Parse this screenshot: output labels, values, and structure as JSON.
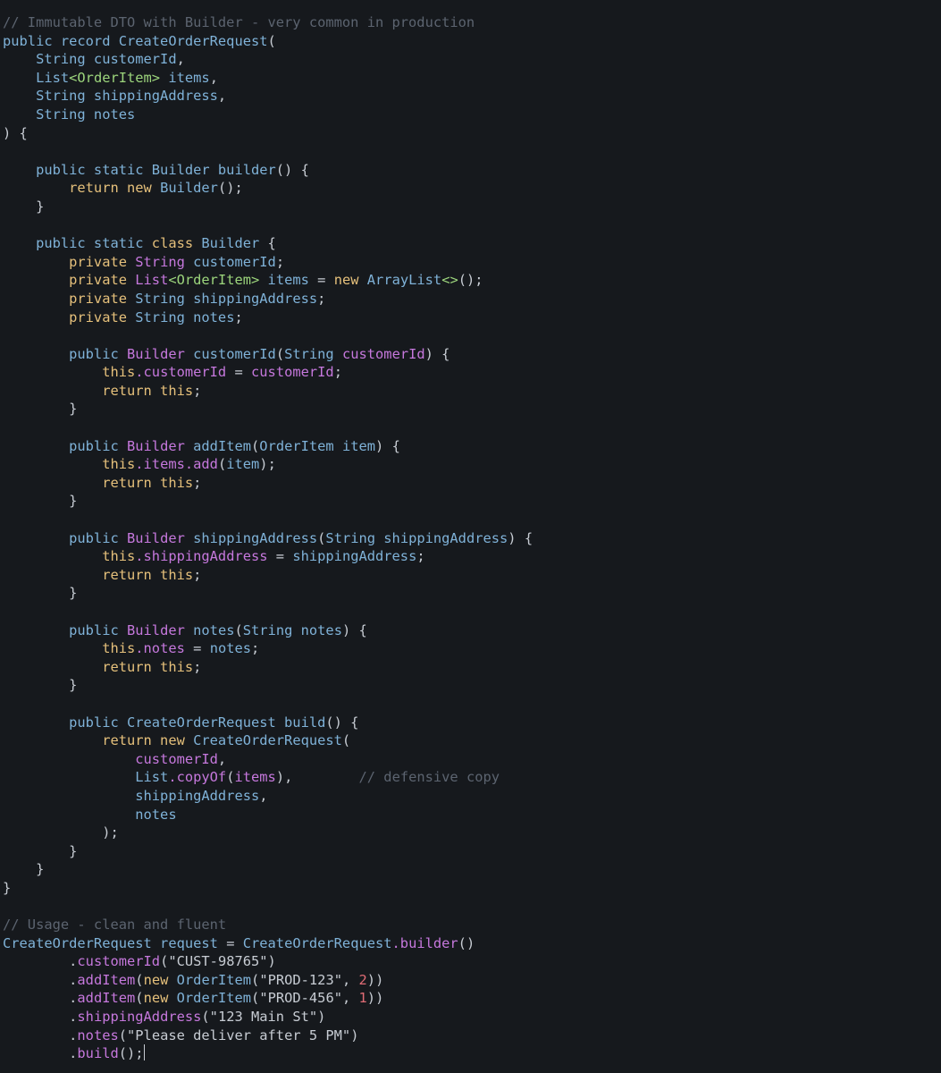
{
  "editor": {
    "colors": {
      "background": "#16191d",
      "comment": "#5c6470",
      "keyword": "#7fb2d8",
      "keyword_accent": "#e5c07b",
      "type": "#7fb2d8",
      "class_name": "#c678dd",
      "generic_type": "#9cd57c",
      "member": "#c678dd",
      "string": "#c7ccd3",
      "number": "#e06c75",
      "punctuation": "#c7ccd3"
    },
    "lines": [
      [
        {
          "t": "// Immutable DTO with Builder - very common in production",
          "c": "comment"
        }
      ],
      [
        {
          "t": "public record CreateOrderRequest",
          "c": "keyword"
        },
        {
          "t": "(",
          "c": "punctuation"
        }
      ],
      [
        {
          "t": "    String customerId",
          "c": "keyword"
        },
        {
          "t": ",",
          "c": "punctuation"
        }
      ],
      [
        {
          "t": "    List",
          "c": "keyword"
        },
        {
          "t": "<OrderItem>",
          "c": "generic_type"
        },
        {
          "t": " items",
          "c": "keyword"
        },
        {
          "t": ",",
          "c": "punctuation"
        }
      ],
      [
        {
          "t": "    String shippingAddress",
          "c": "keyword"
        },
        {
          "t": ",",
          "c": "punctuation"
        }
      ],
      [
        {
          "t": "    String notes",
          "c": "keyword"
        }
      ],
      [
        {
          "t": ") {",
          "c": "punctuation"
        }
      ],
      [
        {
          "t": "",
          "c": "punctuation"
        }
      ],
      [
        {
          "t": "    public static Builder builder",
          "c": "keyword"
        },
        {
          "t": "() {",
          "c": "punctuation"
        }
      ],
      [
        {
          "t": "        return new",
          "c": "keyword_accent"
        },
        {
          "t": " Builder",
          "c": "keyword"
        },
        {
          "t": "();",
          "c": "punctuation"
        }
      ],
      [
        {
          "t": "    }",
          "c": "punctuation"
        }
      ],
      [
        {
          "t": "",
          "c": "punctuation"
        }
      ],
      [
        {
          "t": "    public static ",
          "c": "keyword"
        },
        {
          "t": "class",
          "c": "keyword_accent"
        },
        {
          "t": " Builder",
          "c": "keyword"
        },
        {
          "t": " {",
          "c": "punctuation"
        }
      ],
      [
        {
          "t": "        private",
          "c": "keyword_accent"
        },
        {
          "t": " String",
          "c": "class_name"
        },
        {
          "t": " customerId",
          "c": "keyword"
        },
        {
          "t": ";",
          "c": "punctuation"
        }
      ],
      [
        {
          "t": "        private",
          "c": "keyword_accent"
        },
        {
          "t": " List",
          "c": "class_name"
        },
        {
          "t": "<OrderItem>",
          "c": "generic_type"
        },
        {
          "t": " items",
          "c": "keyword"
        },
        {
          "t": " = ",
          "c": "punctuation"
        },
        {
          "t": "new",
          "c": "keyword_accent"
        },
        {
          "t": " ArrayList",
          "c": "keyword"
        },
        {
          "t": "<>",
          "c": "generic_type"
        },
        {
          "t": "();",
          "c": "punctuation"
        }
      ],
      [
        {
          "t": "        private",
          "c": "keyword_accent"
        },
        {
          "t": " String shippingAddress",
          "c": "keyword"
        },
        {
          "t": ";",
          "c": "punctuation"
        }
      ],
      [
        {
          "t": "        private",
          "c": "keyword_accent"
        },
        {
          "t": " String notes",
          "c": "keyword"
        },
        {
          "t": ";",
          "c": "punctuation"
        }
      ],
      [
        {
          "t": "",
          "c": "punctuation"
        }
      ],
      [
        {
          "t": "        public",
          "c": "keyword"
        },
        {
          "t": " Builder",
          "c": "class_name"
        },
        {
          "t": " customerId",
          "c": "keyword"
        },
        {
          "t": "(",
          "c": "punctuation"
        },
        {
          "t": "String",
          "c": "keyword"
        },
        {
          "t": " customerId",
          "c": "member"
        },
        {
          "t": ") {",
          "c": "punctuation"
        }
      ],
      [
        {
          "t": "            this",
          "c": "keyword_accent"
        },
        {
          "t": ".customerId",
          "c": "member"
        },
        {
          "t": " = ",
          "c": "punctuation"
        },
        {
          "t": "customerId",
          "c": "member"
        },
        {
          "t": ";",
          "c": "punctuation"
        }
      ],
      [
        {
          "t": "            return this",
          "c": "keyword_accent"
        },
        {
          "t": ";",
          "c": "punctuation"
        }
      ],
      [
        {
          "t": "        }",
          "c": "punctuation"
        }
      ],
      [
        {
          "t": "",
          "c": "punctuation"
        }
      ],
      [
        {
          "t": "        public",
          "c": "keyword"
        },
        {
          "t": " Builder",
          "c": "class_name"
        },
        {
          "t": " addItem",
          "c": "keyword"
        },
        {
          "t": "(",
          "c": "punctuation"
        },
        {
          "t": "OrderItem item",
          "c": "keyword"
        },
        {
          "t": ") {",
          "c": "punctuation"
        }
      ],
      [
        {
          "t": "            this",
          "c": "keyword_accent"
        },
        {
          "t": ".items.add",
          "c": "member"
        },
        {
          "t": "(",
          "c": "punctuation"
        },
        {
          "t": "item",
          "c": "keyword"
        },
        {
          "t": ");",
          "c": "punctuation"
        }
      ],
      [
        {
          "t": "            return this",
          "c": "keyword_accent"
        },
        {
          "t": ";",
          "c": "punctuation"
        }
      ],
      [
        {
          "t": "        }",
          "c": "punctuation"
        }
      ],
      [
        {
          "t": "",
          "c": "punctuation"
        }
      ],
      [
        {
          "t": "        public",
          "c": "keyword"
        },
        {
          "t": " Builder",
          "c": "class_name"
        },
        {
          "t": " shippingAddress",
          "c": "keyword"
        },
        {
          "t": "(",
          "c": "punctuation"
        },
        {
          "t": "String shippingAddress",
          "c": "keyword"
        },
        {
          "t": ") {",
          "c": "punctuation"
        }
      ],
      [
        {
          "t": "            this",
          "c": "keyword_accent"
        },
        {
          "t": ".shippingAddress",
          "c": "member"
        },
        {
          "t": " = ",
          "c": "punctuation"
        },
        {
          "t": "shippingAddress",
          "c": "keyword"
        },
        {
          "t": ";",
          "c": "punctuation"
        }
      ],
      [
        {
          "t": "            return this",
          "c": "keyword_accent"
        },
        {
          "t": ";",
          "c": "punctuation"
        }
      ],
      [
        {
          "t": "        }",
          "c": "punctuation"
        }
      ],
      [
        {
          "t": "",
          "c": "punctuation"
        }
      ],
      [
        {
          "t": "        public",
          "c": "keyword"
        },
        {
          "t": " Builder",
          "c": "class_name"
        },
        {
          "t": " notes",
          "c": "keyword"
        },
        {
          "t": "(",
          "c": "punctuation"
        },
        {
          "t": "String notes",
          "c": "keyword"
        },
        {
          "t": ") {",
          "c": "punctuation"
        }
      ],
      [
        {
          "t": "            this",
          "c": "keyword_accent"
        },
        {
          "t": ".notes",
          "c": "member"
        },
        {
          "t": " = ",
          "c": "punctuation"
        },
        {
          "t": "notes",
          "c": "keyword"
        },
        {
          "t": ";",
          "c": "punctuation"
        }
      ],
      [
        {
          "t": "            return this",
          "c": "keyword_accent"
        },
        {
          "t": ";",
          "c": "punctuation"
        }
      ],
      [
        {
          "t": "        }",
          "c": "punctuation"
        }
      ],
      [
        {
          "t": "",
          "c": "punctuation"
        }
      ],
      [
        {
          "t": "        public CreateOrderRequest build",
          "c": "keyword"
        },
        {
          "t": "() {",
          "c": "punctuation"
        }
      ],
      [
        {
          "t": "            return new",
          "c": "keyword_accent"
        },
        {
          "t": " CreateOrderRequest",
          "c": "keyword"
        },
        {
          "t": "(",
          "c": "punctuation"
        }
      ],
      [
        {
          "t": "                customerId",
          "c": "member"
        },
        {
          "t": ",",
          "c": "punctuation"
        }
      ],
      [
        {
          "t": "                List",
          "c": "keyword"
        },
        {
          "t": ".copyOf",
          "c": "member"
        },
        {
          "t": "(",
          "c": "punctuation"
        },
        {
          "t": "items",
          "c": "member"
        },
        {
          "t": "),",
          "c": "punctuation"
        },
        {
          "t": "        // defensive copy",
          "c": "comment"
        }
      ],
      [
        {
          "t": "                shippingAddress",
          "c": "keyword"
        },
        {
          "t": ",",
          "c": "punctuation"
        }
      ],
      [
        {
          "t": "                notes",
          "c": "keyword"
        }
      ],
      [
        {
          "t": "            );",
          "c": "punctuation"
        }
      ],
      [
        {
          "t": "        }",
          "c": "punctuation"
        }
      ],
      [
        {
          "t": "    }",
          "c": "punctuation"
        }
      ],
      [
        {
          "t": "}",
          "c": "punctuation"
        }
      ],
      [
        {
          "t": "",
          "c": "punctuation"
        }
      ],
      [
        {
          "t": "// Usage - clean and fluent",
          "c": "comment"
        }
      ],
      [
        {
          "t": "CreateOrderRequest request",
          "c": "keyword"
        },
        {
          "t": " = ",
          "c": "punctuation"
        },
        {
          "t": "CreateOrderRequest",
          "c": "keyword"
        },
        {
          "t": ".builder",
          "c": "member"
        },
        {
          "t": "()",
          "c": "punctuation"
        }
      ],
      [
        {
          "t": "        .",
          "c": "punctuation"
        },
        {
          "t": "customerId",
          "c": "member"
        },
        {
          "t": "(\"CUST-98765\")",
          "c": "string"
        }
      ],
      [
        {
          "t": "        .",
          "c": "punctuation"
        },
        {
          "t": "addItem",
          "c": "member"
        },
        {
          "t": "(",
          "c": "punctuation"
        },
        {
          "t": "new",
          "c": "keyword_accent"
        },
        {
          "t": " OrderItem",
          "c": "keyword"
        },
        {
          "t": "(\"PROD-123\", ",
          "c": "string"
        },
        {
          "t": "2",
          "c": "number"
        },
        {
          "t": "))",
          "c": "punctuation"
        }
      ],
      [
        {
          "t": "        .",
          "c": "punctuation"
        },
        {
          "t": "addItem",
          "c": "member"
        },
        {
          "t": "(",
          "c": "punctuation"
        },
        {
          "t": "new",
          "c": "keyword_accent"
        },
        {
          "t": " OrderItem",
          "c": "keyword"
        },
        {
          "t": "(\"PROD-456\", ",
          "c": "string"
        },
        {
          "t": "1",
          "c": "number"
        },
        {
          "t": "))",
          "c": "punctuation"
        }
      ],
      [
        {
          "t": "        .",
          "c": "punctuation"
        },
        {
          "t": "shippingAddress",
          "c": "member"
        },
        {
          "t": "(\"123 Main St\")",
          "c": "string"
        }
      ],
      [
        {
          "t": "        .",
          "c": "punctuation"
        },
        {
          "t": "notes",
          "c": "member"
        },
        {
          "t": "(\"Please deliver after 5 PM\")",
          "c": "string"
        }
      ],
      [
        {
          "t": "        .",
          "c": "punctuation"
        },
        {
          "t": "build",
          "c": "member"
        },
        {
          "t": "();",
          "c": "punctuation"
        }
      ]
    ],
    "cursor_line": 56
  }
}
